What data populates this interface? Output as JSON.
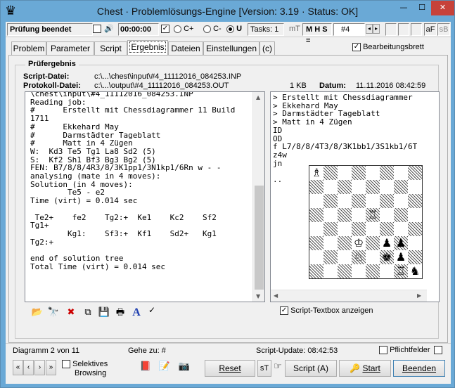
{
  "window": {
    "title": "Chest · Problemlösungs-Engine [Version: 3.19 · Status: OK]",
    "app_icon": "♛",
    "min": "—",
    "max": "☐",
    "close": "✕"
  },
  "toolbar": {
    "status": "Prüfung beendet",
    "speaker_icon": "🔊",
    "timer": "00:00:00",
    "check_mark": "✓",
    "radio_cplus": "C+",
    "radio_cminus": "C-",
    "radio_u": "U",
    "tasks": "Tasks: 1",
    "mt": "mT",
    "mhs": "M H S =",
    "hash": "#4",
    "af": "aF",
    "sb": "sB"
  },
  "tabs": [
    "Problem",
    "Parameter",
    "Script",
    "Ergebnis",
    "Dateien",
    "Einstellungen",
    "(c)"
  ],
  "active_tab": "Ergebnis",
  "bearbeitungsbrett": "Bearbeitungsbrett",
  "group": {
    "title": "Prüfergebnis",
    "script_label": "Script-Datei:",
    "script_path": "c:\\...\\chest\\input\\#4_11112016_084253.INP",
    "protokoll_label": "Protokoll-Datei:",
    "protokoll_path": "c:\\...\\output\\#4_11112016_084253.OUT",
    "size": "1 KB",
    "datum_label": "Datum:",
    "datum": "11.11.2016 08:42:59"
  },
  "left_memo": "\\chest\\input\\#4_11112016_084253.INP\nReading job:\n#      Erstellt mit Chessdiagrammer 11 Build\n1711\n#      Ekkehard May\n#      Darmstädter Tageblatt\n#      Matt in 4 Zügen\nW:  Kd3 Te5 Tg1 La8 Sd2 (5)\nS:  Kf2 Sh1 Bf3 Bg3 Bg2 (5)\nFEN: B7/8/8/4R3/8/3K1pp1/3N1kp1/6Rn w - -\nanalysing (mate in 4 moves):\nSolution (in 4 moves):\n        Te5 - e2\nTime (virt) = 0.014 sec\n\n Te2+    fe2    Tg2:+  Ke1    Kc2    Sf2\nTg1+\n        Kg1:    Sf3:+  Kf1    Sd2+   Kg1\nTg2:+\n\nend of solution tree\nTotal Time (virt) = 0.014 sec",
  "right_memo": "> Erstellt mit Chessdiagrammer\n> Ekkehard May\n> Darmstädter Tageblatt\n> Matt in 4 Zügen\nID\nOD\nf L7/8/8/4T3/8/3K1bb1/3S1kb1/6T\nz4w\njn\n\n..",
  "script_textbox_label": "Script-Textbox anzeigen",
  "board": [
    [
      "♗",
      "",
      "",
      "",
      "",
      "",
      "",
      ""
    ],
    [
      "",
      "",
      "",
      "",
      "",
      "",
      "",
      ""
    ],
    [
      "",
      "",
      "",
      "",
      "",
      "",
      "",
      ""
    ],
    [
      "",
      "",
      "",
      "",
      "♖",
      "",
      "",
      ""
    ],
    [
      "",
      "",
      "",
      "",
      "",
      "",
      "",
      ""
    ],
    [
      "",
      "",
      "",
      "♔",
      "",
      "♟",
      "♟",
      ""
    ],
    [
      "",
      "",
      "",
      "♘",
      "",
      "♚",
      "♟",
      ""
    ],
    [
      "",
      "",
      "",
      "",
      "",
      "",
      "♖",
      "♞"
    ]
  ],
  "statusbar": {
    "diagramm": "Diagramm 2 von 11",
    "gehe_zu": "Gehe zu: #",
    "script_update": "Script-Update: 08:42:53",
    "pflichtfelder": "Pflichtfelder"
  },
  "nav": {
    "first": "«",
    "prev": "‹",
    "next": "›",
    "last": "»",
    "selektives": "Selektives",
    "browsing": "Browsing"
  },
  "buttons": {
    "reset": "Reset",
    "st": "sT",
    "script": "Script (A)",
    "start": "Start",
    "beenden": "Beenden"
  }
}
